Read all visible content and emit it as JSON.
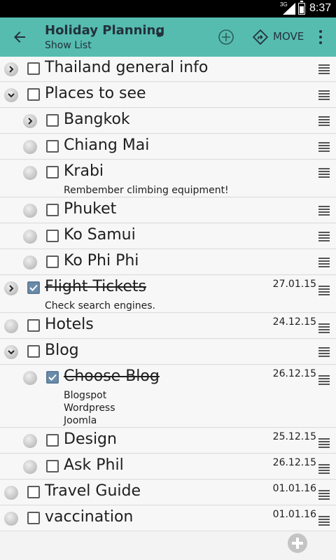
{
  "status_bar": {
    "network": "3G",
    "time": "8:37"
  },
  "app_bar": {
    "title": "Holiday Planning",
    "subtitle": "Show List",
    "move_label": "MOVE",
    "color": "#56bcb0"
  },
  "items": [
    {
      "label": "Thailand general info",
      "level": 0,
      "expander": "collapsed",
      "checked": false
    },
    {
      "label": "Places to see",
      "level": 0,
      "expander": "expanded",
      "checked": false
    },
    {
      "label": "Bangkok",
      "level": 1,
      "expander": "collapsed",
      "checked": false
    },
    {
      "label": "Chiang Mai",
      "level": 1,
      "expander": "none",
      "checked": false
    },
    {
      "label": "Krabi",
      "level": 1,
      "expander": "none",
      "checked": false,
      "note": [
        "Rembember climbing equipment!"
      ]
    },
    {
      "label": "Phuket",
      "level": 1,
      "expander": "none",
      "checked": false
    },
    {
      "label": "Ko Samui",
      "level": 1,
      "expander": "none",
      "checked": false
    },
    {
      "label": "Ko Phi Phi",
      "level": 1,
      "expander": "none",
      "checked": false
    },
    {
      "label": "Flight Tickets",
      "level": 0,
      "expander": "collapsed",
      "checked": true,
      "date": "27.01.15",
      "note": [
        "Check search engines."
      ]
    },
    {
      "label": "Hotels",
      "level": 0,
      "expander": "none",
      "checked": false,
      "date": "24.12.15"
    },
    {
      "label": "Blog",
      "level": 0,
      "expander": "expanded",
      "checked": false
    },
    {
      "label": "Choose Blog",
      "level": 1,
      "expander": "none",
      "checked": true,
      "date": "26.12.15",
      "note": [
        "Blogspot",
        "Wordpress",
        "Joomla"
      ]
    },
    {
      "label": "Design",
      "level": 1,
      "expander": "none",
      "checked": false,
      "date": "25.12.15"
    },
    {
      "label": "Ask Phil",
      "level": 1,
      "expander": "none",
      "checked": false,
      "date": "26.12.15"
    },
    {
      "label": "Travel Guide",
      "level": 0,
      "expander": "none",
      "checked": false,
      "date": "01.01.16"
    },
    {
      "label": "vaccination",
      "level": 0,
      "expander": "none",
      "checked": false,
      "date": "01.01.16"
    }
  ],
  "icons": {
    "back": "arrow-left-icon",
    "add": "add-circle-icon",
    "move": "move-icon",
    "overflow": "more-vert-icon",
    "drag": "drag-handle-icon",
    "fab": "add-item-icon"
  }
}
